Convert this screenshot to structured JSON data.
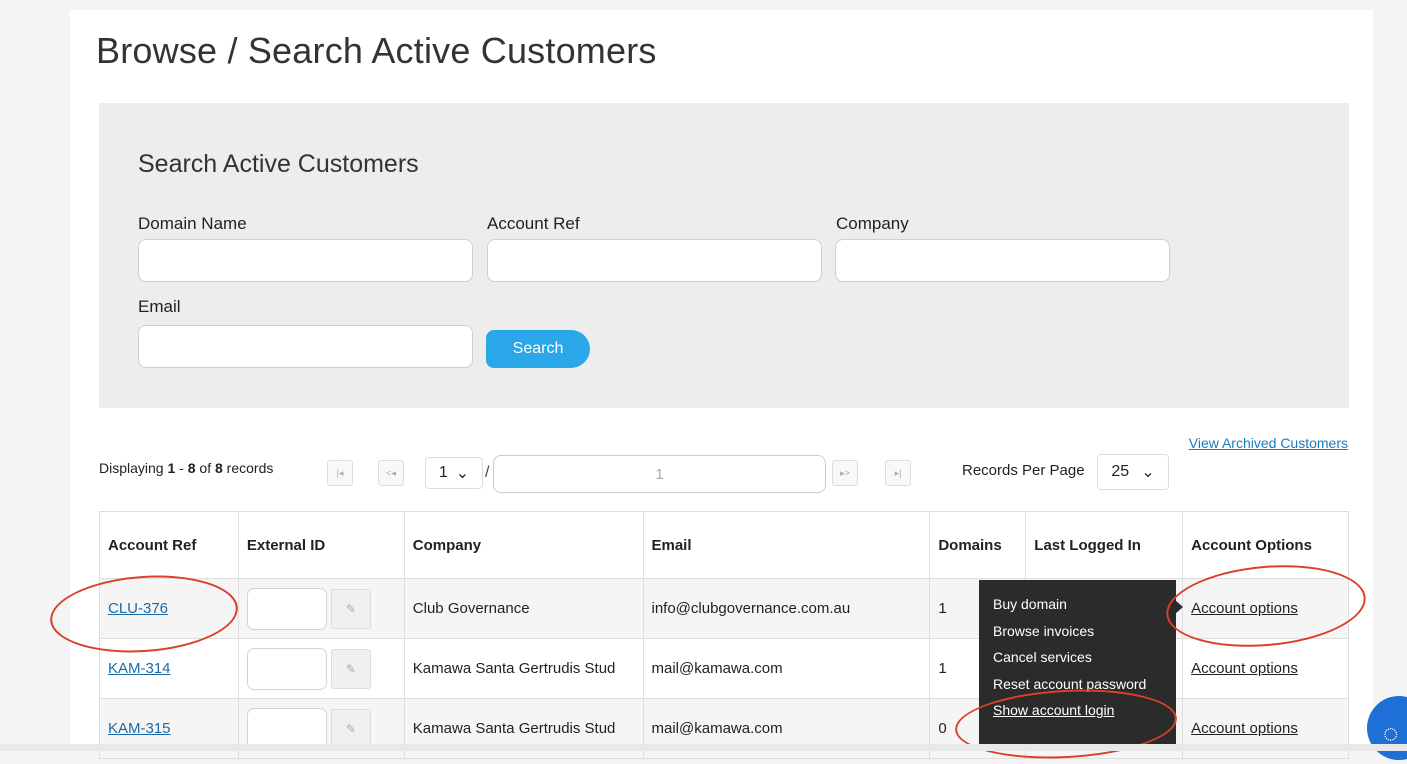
{
  "page": {
    "title": "Browse / Search Active Customers"
  },
  "search": {
    "title": "Search Active Customers",
    "fields": {
      "domain": {
        "label": "Domain Name",
        "value": ""
      },
      "account_ref": {
        "label": "Account Ref",
        "value": ""
      },
      "company": {
        "label": "Company",
        "value": ""
      },
      "email": {
        "label": "Email",
        "value": ""
      }
    },
    "button": "Search"
  },
  "archived_link": "View Archived Customers",
  "pagination": {
    "displaying_prefix": "Displaying ",
    "range_start": "1",
    "range_sep": " - ",
    "range_end": "8",
    "of": " of ",
    "total": "8",
    "records": " records",
    "first": "|◂",
    "prev": "<◂",
    "next": "▸>",
    "last": "▸|",
    "page_select": "1",
    "slash": "/",
    "page_input": "1",
    "records_per_page_label": "Records Per Page",
    "records_per_page": "25"
  },
  "table": {
    "headers": [
      "Account Ref",
      "External ID",
      "Company",
      "Email",
      "Domains",
      "Last Logged In",
      "Account Options"
    ],
    "rows": [
      {
        "ref": "CLU-376",
        "company": "Club Governance",
        "email": "info@clubgovernance.com.au",
        "domains": "1",
        "last_login": "",
        "options": "Account options"
      },
      {
        "ref": "KAM-314",
        "company": "Kamawa Santa Gertrudis Stud",
        "email": "mail@kamawa.com",
        "domains": "1",
        "last_login": "",
        "options": "Account options"
      },
      {
        "ref": "KAM-315",
        "company": "Kamawa Santa Gertrudis Stud",
        "email": "mail@kamawa.com",
        "domains": "0",
        "last_login": "",
        "options": "Account options"
      }
    ]
  },
  "options_menu": {
    "items": [
      "Buy domain",
      "Browse invoices",
      "Cancel services",
      "Reset account password",
      "Show account login"
    ]
  },
  "icons": {
    "edit": "pencil-icon",
    "chat": "chat-icon",
    "dropdown": "chevron-down-icon"
  },
  "colors": {
    "accent": "#2aa7e8",
    "link": "#1a6aa8",
    "annotation": "#d9412b",
    "menu_bg": "#2b2b2b"
  }
}
